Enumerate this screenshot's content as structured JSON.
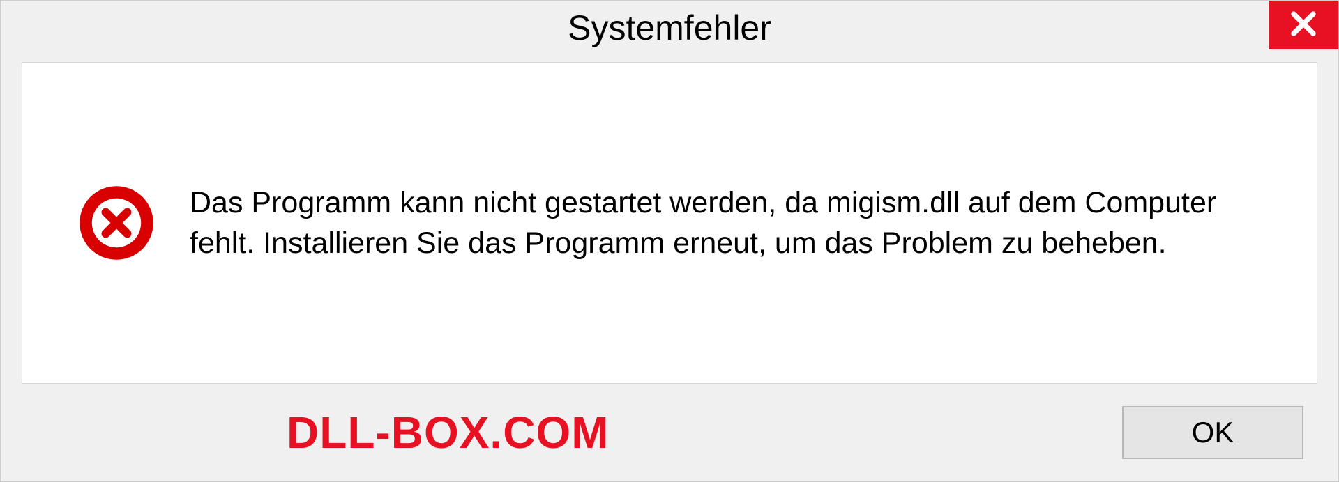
{
  "dialog": {
    "title": "Systemfehler",
    "message": "Das Programm kann nicht gestartet werden, da migism.dll auf dem Computer fehlt. Installieren Sie das Programm erneut, um das Problem zu beheben.",
    "ok_label": "OK"
  },
  "watermark": "DLL-BOX.COM",
  "colors": {
    "close_red": "#e81123",
    "error_red": "#d80000"
  }
}
